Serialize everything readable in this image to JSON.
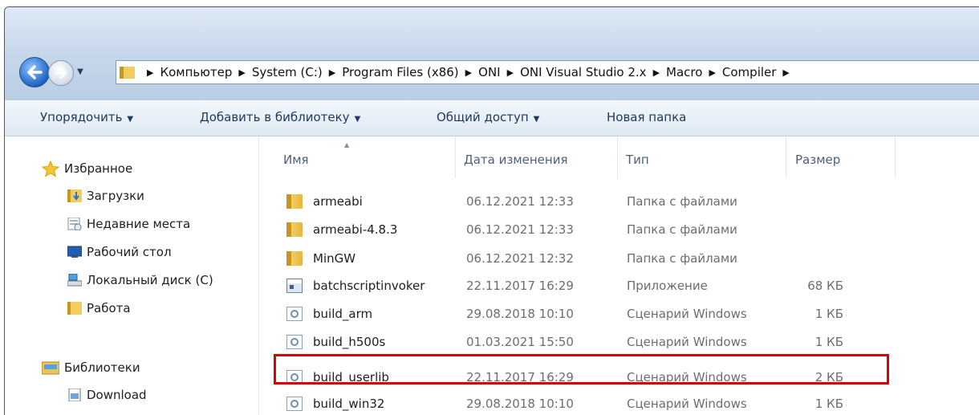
{
  "address_bar": {
    "crumbs": [
      "Компьютер",
      "System (C:)",
      "Program Files (x86)",
      "ONI",
      "ONI Visual Studio 2.x",
      "Macro",
      "Compiler"
    ]
  },
  "toolbar": {
    "organize": "Упорядочить",
    "add_to_library": "Добавить в библиотеку",
    "share": "Общий доступ",
    "new_folder": "Новая папка"
  },
  "sidebar": {
    "favorites_header": "Избранное",
    "favorites": [
      "Загрузки",
      "Недавние места",
      "Рабочий стол",
      "Локальный диск (C)",
      "Работа"
    ],
    "libraries_header": "Библиотеки",
    "libraries": [
      "Download"
    ]
  },
  "columns": {
    "name": "Имя",
    "date": "Дата изменения",
    "type": "Тип",
    "size": "Размер"
  },
  "files": [
    {
      "name": "armeabi",
      "date": "06.12.2021 12:33",
      "type": "Папка с файлами",
      "size": "",
      "icon": "folder-icon"
    },
    {
      "name": "armeabi-4.8.3",
      "date": "06.12.2021 12:33",
      "type": "Папка с файлами",
      "size": "",
      "icon": "folder-icon"
    },
    {
      "name": "MinGW",
      "date": "06.12.2021 12:32",
      "type": "Папка с файлами",
      "size": "",
      "icon": "folder-icon"
    },
    {
      "name": "batchscriptinvoker",
      "date": "22.11.2017 16:29",
      "type": "Приложение",
      "size": "68 КБ",
      "icon": "application-icon"
    },
    {
      "name": "build_arm",
      "date": "29.08.2018 10:10",
      "type": "Сценарий Windows",
      "size": "1 КБ",
      "icon": "script-icon"
    },
    {
      "name": "build_h500s",
      "date": "01.03.2021 15:50",
      "type": "Сценарий Windows",
      "size": "1 КБ",
      "icon": "script-icon"
    },
    {
      "name": "build_userlib",
      "date": "22.11.2017 16:29",
      "type": "Сценарий Windows",
      "size": "2 КБ",
      "icon": "script-icon"
    },
    {
      "name": "build_win32",
      "date": "29.08.2018 10:10",
      "type": "Сценарий Windows",
      "size": "1 КБ",
      "icon": "script-icon"
    }
  ],
  "highlighted_file": "build_userlib",
  "colors": {
    "highlight_border": "#e00000",
    "toolbar_text": "#1e395b"
  }
}
